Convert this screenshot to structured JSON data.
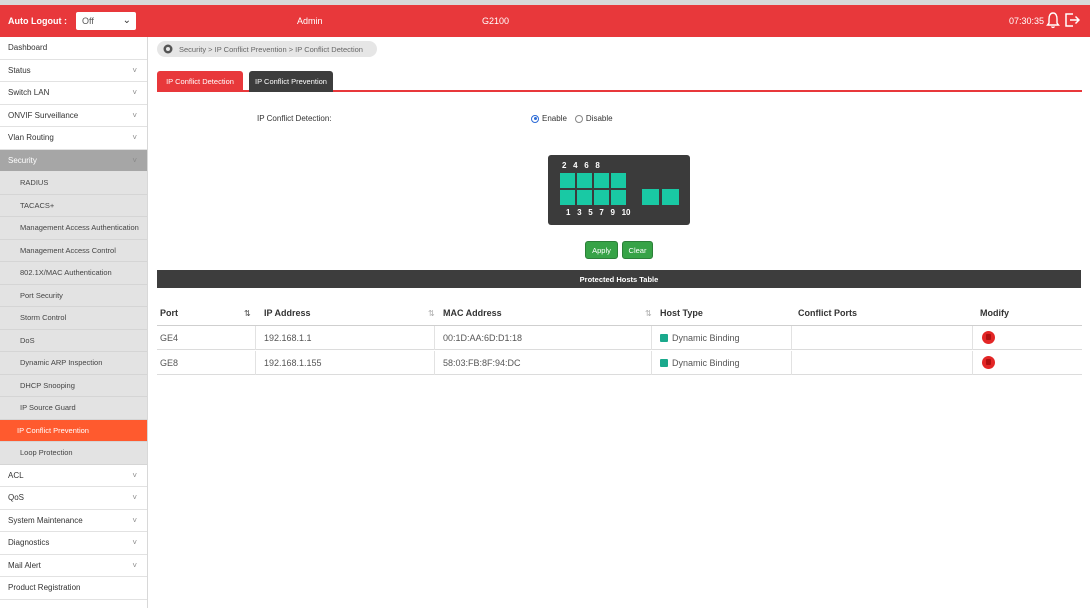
{
  "header": {
    "auto_logout_label": "Auto Logout :",
    "auto_logout_value": "Off",
    "user": "Admin",
    "model": "G2100",
    "time": "07:30:35"
  },
  "sidebar": {
    "items": [
      {
        "label": "Dashboard",
        "chevron": false
      },
      {
        "label": "Status",
        "chevron": true
      },
      {
        "label": "Switch LAN",
        "chevron": true
      },
      {
        "label": "ONVIF Surveillance",
        "chevron": true
      },
      {
        "label": "Vlan Routing",
        "chevron": true
      },
      {
        "label": "Security",
        "chevron": true,
        "open": true
      }
    ],
    "security_sub": [
      "RADIUS",
      "TACACS+",
      "Management Access Authentication",
      "Management Access Control",
      "802.1X/MAC Authentication",
      "Port Security",
      "Storm Control",
      "DoS",
      "Dynamic ARP Inspection",
      "DHCP Snooping",
      "IP Source Guard",
      "IP Conflict Prevention",
      "Loop Protection"
    ],
    "active_sub": "IP Conflict Prevention",
    "items_after": [
      {
        "label": "ACL",
        "chevron": true
      },
      {
        "label": "QoS",
        "chevron": true
      },
      {
        "label": "System Maintenance",
        "chevron": true
      },
      {
        "label": "Diagnostics",
        "chevron": true
      },
      {
        "label": "Mail Alert",
        "chevron": true
      },
      {
        "label": "Product Registration",
        "chevron": false
      }
    ]
  },
  "breadcrumb": "Security > IP Conflict Prevention > IP Conflict Detection",
  "tabs": [
    {
      "label": "IP Conflict Detection",
      "active": true
    },
    {
      "label": "IP Conflict Prevention",
      "active": false
    }
  ],
  "detection": {
    "label": "IP Conflict Detection:",
    "options": [
      "Enable",
      "Disable"
    ],
    "selected": "Enable"
  },
  "switch_panel": {
    "top_ports": "2   4   6   8",
    "bottom_ports": "1   3   5   7   9   10"
  },
  "buttons": {
    "apply": "Apply",
    "clear": "Clear"
  },
  "table": {
    "title": "Protected Hosts Table",
    "columns": [
      "Port",
      "IP Address",
      "MAC Address",
      "Host Type",
      "Conflict Ports",
      "Modify"
    ],
    "rows": [
      {
        "port": "GE4",
        "ip": "192.168.1.1",
        "mac": "00:1D:AA:6D:D1:18",
        "host_type": "Dynamic Binding",
        "conflict_ports": ""
      },
      {
        "port": "GE8",
        "ip": "192.168.1.155",
        "mac": "58:03:FB:8F:94:DC",
        "host_type": "Dynamic Binding",
        "conflict_ports": ""
      }
    ]
  },
  "colors": {
    "accent": "#e8383b",
    "active_menu": "#ff5a2e",
    "port": "#19c9a4",
    "button": "#37a347"
  }
}
